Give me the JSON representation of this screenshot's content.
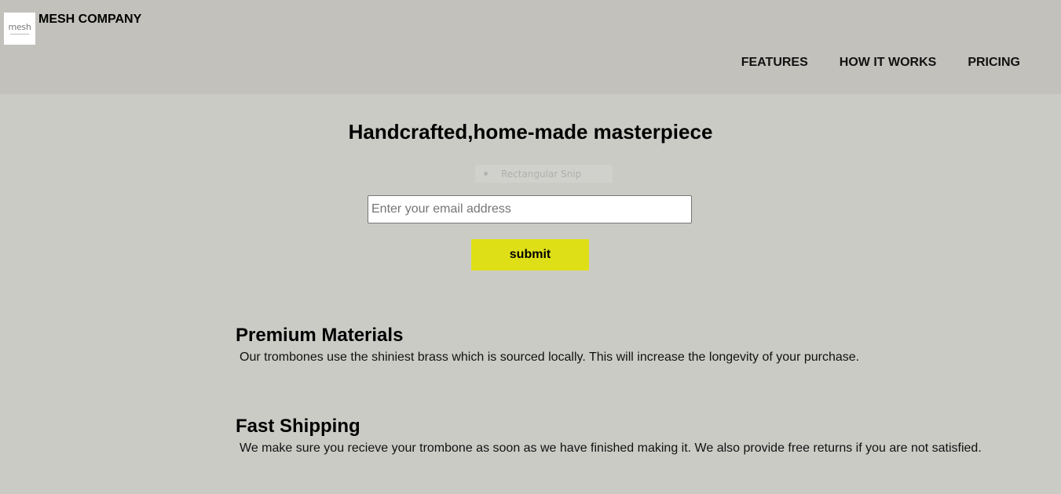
{
  "header": {
    "logo_text": "mesh",
    "company_name": "MESH COMPANY",
    "nav": [
      {
        "label": "FEATURES"
      },
      {
        "label": "HOW IT WORKS"
      },
      {
        "label": "PRICING"
      }
    ]
  },
  "hero": {
    "title": "Handcrafted,home-made masterpiece",
    "snip_overlay_label": "Rectangular Snip",
    "email_placeholder": "Enter your email address",
    "submit_label": "submit"
  },
  "features": [
    {
      "title": "Premium Materials",
      "description": "Our trombones use the shiniest brass which is sourced locally. This will increase the longevity of your purchase."
    },
    {
      "title": "Fast Shipping",
      "description": "We make sure you recieve your trombone as soon as we have finished making it. We also provide free returns if you are not satisfied."
    }
  ],
  "colors": {
    "header_bg": "#c2c1bc",
    "page_bg": "#cbcbc6",
    "submit_bg": "#dfdf18"
  }
}
